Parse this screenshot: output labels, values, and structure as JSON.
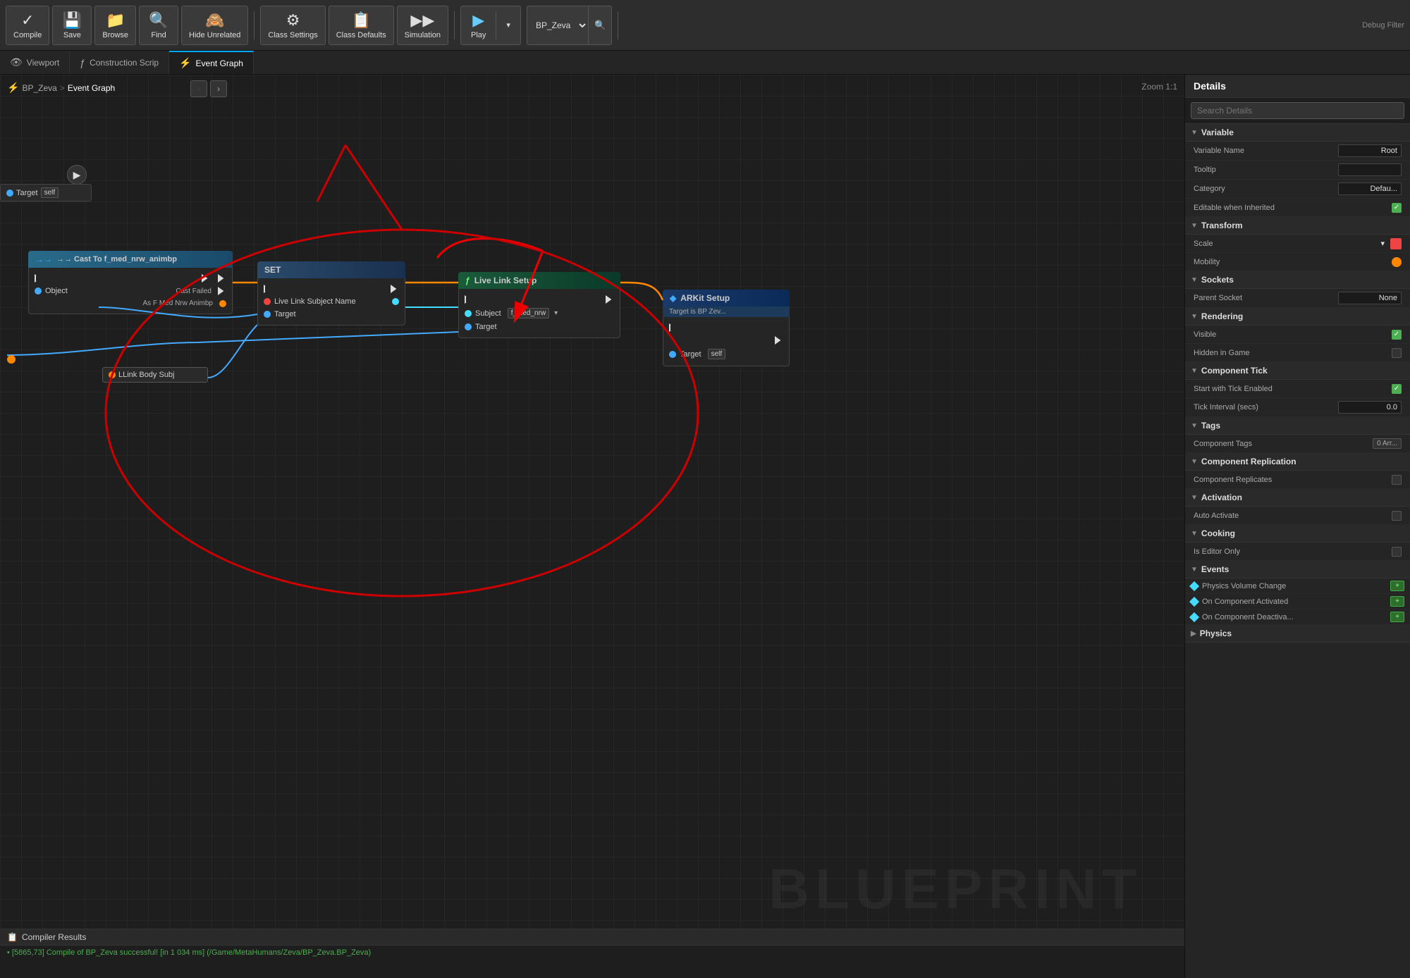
{
  "toolbar": {
    "compile_label": "Compile",
    "save_label": "Save",
    "browse_label": "Browse",
    "find_label": "Find",
    "hide_unrelated_label": "Hide Unrelated",
    "class_settings_label": "Class Settings",
    "class_defaults_label": "Class Defaults",
    "simulation_label": "Simulation",
    "play_label": "Play",
    "debug_filter_label": "Debug Filter",
    "bp_zeva_label": "BP_Zeva"
  },
  "tabs": [
    {
      "label": "Viewport",
      "icon": "👁",
      "active": false
    },
    {
      "label": "Construction Scrip",
      "icon": "ƒ",
      "active": false
    },
    {
      "label": "Event Graph",
      "icon": "⚡",
      "active": true
    }
  ],
  "canvas": {
    "breadcrumb": {
      "icon": "⚡",
      "blueprint": "BP_Zeva",
      "separator": ">",
      "graph": "Event Graph"
    },
    "zoom": "Zoom 1:1",
    "watermark": "BLUEPRINT"
  },
  "nodes": {
    "target": {
      "label": "Target",
      "value": "self"
    },
    "cast": {
      "header": "→→ Cast To f_med_nrw_animbp",
      "pins": [
        {
          "name": "Object",
          "side": "left"
        },
        {
          "name": "Cast Failed",
          "side": "right"
        },
        {
          "name": "As F Med Nrw Animbp",
          "side": "right"
        }
      ]
    },
    "set": {
      "header": "SET",
      "pins": [
        {
          "name": "Live Link Subject Name",
          "side": "left"
        },
        {
          "name": "Target",
          "side": "left"
        }
      ]
    },
    "livelink": {
      "header": "Live Link Setup",
      "pins": [
        {
          "name": "Subject",
          "side": "left",
          "value": "f_med_nrw"
        },
        {
          "name": "Target",
          "side": "left"
        }
      ]
    },
    "arkit": {
      "header": "ARKit Setup",
      "sub": "Target is BP Zev...",
      "pins": [
        {
          "name": "Target",
          "side": "left",
          "value": "self"
        }
      ]
    },
    "llinkbody": {
      "label": "LLink Body Subj"
    }
  },
  "compiler": {
    "title": "Compiler Results",
    "message": "• [5865,73] Compile of BP_Zeva successful! [in 1 034 ms] (/Game/MetaHumans/Zeva/BP_Zeva.BP_Zeva)"
  },
  "details": {
    "title": "Details",
    "search_placeholder": "Search Details",
    "sections": {
      "variable": {
        "label": "Variable",
        "fields": [
          {
            "key": "Variable Name",
            "value": "Root"
          },
          {
            "key": "Tooltip",
            "value": ""
          },
          {
            "key": "Category",
            "value": "Defau"
          },
          {
            "key": "Editable when Inherited",
            "value": "checkbox_checked"
          }
        ]
      },
      "transform": {
        "label": "Transform",
        "fields": [
          {
            "key": "Scale",
            "value": "dropdown"
          },
          {
            "key": "Mobility",
            "value": "orange_dot"
          }
        ]
      },
      "sockets": {
        "label": "Sockets",
        "fields": [
          {
            "key": "Parent Socket",
            "value": "None"
          }
        ]
      },
      "rendering": {
        "label": "Rendering",
        "fields": [
          {
            "key": "Visible",
            "value": "checkbox_checked"
          },
          {
            "key": "Hidden in Game",
            "value": "checkbox_empty"
          }
        ]
      },
      "component_tick": {
        "label": "Component Tick",
        "fields": [
          {
            "key": "Start with Tick Enabled",
            "value": "checkbox_checked"
          },
          {
            "key": "Tick Interval (secs)",
            "value": "0.0"
          }
        ]
      },
      "tags": {
        "label": "Tags",
        "fields": [
          {
            "key": "Component Tags",
            "value": "0 Arr..."
          }
        ]
      },
      "component_replication": {
        "label": "Component Replication",
        "fields": [
          {
            "key": "Component Replicates",
            "value": "checkbox_empty"
          }
        ]
      },
      "activation": {
        "label": "Activation",
        "fields": [
          {
            "key": "Auto Activate",
            "value": "checkbox_empty"
          }
        ]
      },
      "cooking": {
        "label": "Cooking",
        "fields": [
          {
            "key": "Is Editor Only",
            "value": "checkbox_empty"
          }
        ]
      },
      "events": {
        "label": "Events",
        "items": [
          {
            "name": "Physics Volume Change",
            "has_btn": true
          },
          {
            "name": "On Component Activated",
            "has_btn": true
          },
          {
            "name": "On Component Deactiva...",
            "has_btn": true
          }
        ]
      },
      "physics": {
        "label": "Physics"
      }
    }
  }
}
